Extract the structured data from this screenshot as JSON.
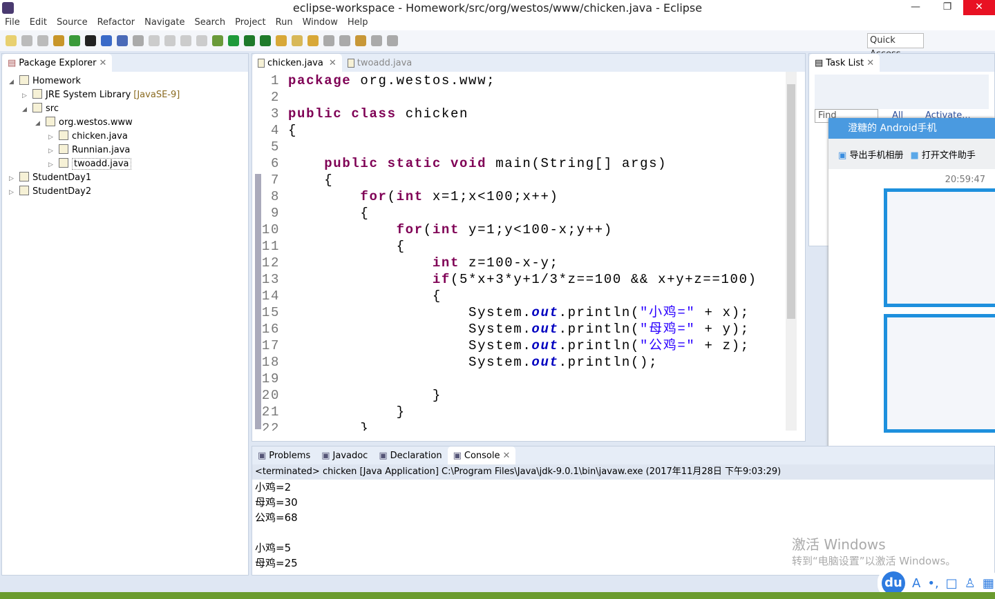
{
  "window": {
    "title": "eclipse-workspace - Homework/src/org/westos/www/chicken.java - Eclipse",
    "minimize": "—",
    "restore": "❐",
    "close": "✕"
  },
  "menu": [
    "File",
    "Edit",
    "Source",
    "Refactor",
    "Navigate",
    "Search",
    "Project",
    "Run",
    "Window",
    "Help"
  ],
  "quick_access": "Quick Access",
  "package_explorer": {
    "title": "Package Explorer",
    "tree": [
      {
        "label": "Homework",
        "depth": 0,
        "open": true
      },
      {
        "label": "JRE System Library",
        "extra": "[JavaSE-9]",
        "depth": 1,
        "open": false
      },
      {
        "label": "src",
        "depth": 1,
        "open": true
      },
      {
        "label": "org.westos.www",
        "depth": 2,
        "open": true
      },
      {
        "label": "chicken.java",
        "depth": 3,
        "open": false
      },
      {
        "label": "Runnian.java",
        "depth": 3,
        "open": false
      },
      {
        "label": "twoadd.java",
        "depth": 3,
        "open": false,
        "selected": true
      },
      {
        "label": "StudentDay1",
        "depth": 0,
        "open": false
      },
      {
        "label": "StudentDay2",
        "depth": 0,
        "open": false
      }
    ]
  },
  "editor": {
    "tabs": [
      {
        "label": "chicken.java",
        "active": true
      },
      {
        "label": "twoadd.java",
        "active": false
      }
    ],
    "lines": [
      [
        [
          "kw",
          "package"
        ],
        [
          "t",
          " org.westos.www;"
        ]
      ],
      [],
      [
        [
          "kw",
          "public"
        ],
        [
          "t",
          " "
        ],
        [
          "kw",
          "class"
        ],
        [
          "t",
          " chicken"
        ]
      ],
      [
        [
          "t",
          "{"
        ]
      ],
      [],
      [
        [
          "t",
          "    "
        ],
        [
          "kw",
          "public"
        ],
        [
          "t",
          " "
        ],
        [
          "kw",
          "static"
        ],
        [
          "t",
          " "
        ],
        [
          "kw",
          "void"
        ],
        [
          "t",
          " main(String[] args)"
        ]
      ],
      [
        [
          "t",
          "    {"
        ]
      ],
      [
        [
          "t",
          "        "
        ],
        [
          "kw",
          "for"
        ],
        [
          "t",
          "("
        ],
        [
          "kw",
          "int"
        ],
        [
          "t",
          " x=1;x<100;x++)"
        ]
      ],
      [
        [
          "t",
          "        {"
        ]
      ],
      [
        [
          "t",
          "            "
        ],
        [
          "kw",
          "for"
        ],
        [
          "t",
          "("
        ],
        [
          "kw",
          "int"
        ],
        [
          "t",
          " y=1;y<100-x;y++)"
        ]
      ],
      [
        [
          "t",
          "            {"
        ]
      ],
      [
        [
          "t",
          "                "
        ],
        [
          "kw",
          "int"
        ],
        [
          "t",
          " z=100-x-y;"
        ]
      ],
      [
        [
          "t",
          "                "
        ],
        [
          "kw",
          "if"
        ],
        [
          "t",
          "(5*x+3*y+1/3*z==100 && x+y+z==100)"
        ]
      ],
      [
        [
          "t",
          "                {"
        ]
      ],
      [
        [
          "t",
          "                    System."
        ],
        [
          "fld",
          "out"
        ],
        [
          "t",
          ".println("
        ],
        [
          "str",
          "\"小鸡=\""
        ],
        [
          "t",
          " + x);"
        ]
      ],
      [
        [
          "t",
          "                    System."
        ],
        [
          "fld",
          "out"
        ],
        [
          "t",
          ".println("
        ],
        [
          "str",
          "\"母鸡=\""
        ],
        [
          "t",
          " + y);"
        ]
      ],
      [
        [
          "t",
          "                    System."
        ],
        [
          "fld",
          "out"
        ],
        [
          "t",
          ".println("
        ],
        [
          "str",
          "\"公鸡=\""
        ],
        [
          "t",
          " + z);"
        ]
      ],
      [
        [
          "t",
          "                    System."
        ],
        [
          "fld",
          "out"
        ],
        [
          "t",
          ".println();"
        ]
      ],
      [],
      [
        [
          "t",
          "                }"
        ]
      ],
      [
        [
          "t",
          "            }"
        ]
      ],
      [
        [
          "t",
          "        }"
        ]
      ]
    ]
  },
  "task_list": {
    "title": "Task List",
    "find_placeholder": "Find",
    "all": "All",
    "activate": "Activate..."
  },
  "qq": {
    "title": "澄糖的 Android手机",
    "export": "导出手机相册",
    "open_helper": "打开文件助手",
    "time": "20:59:47"
  },
  "console": {
    "tabs": [
      "Problems",
      "Javadoc",
      "Declaration",
      "Console"
    ],
    "status": "<terminated> chicken [Java Application] C:\\Program Files\\Java\\jdk-9.0.1\\bin\\javaw.exe (2017年11月28日 下午9:03:29)",
    "output": [
      "小鸡=2",
      "母鸡=30",
      "公鸡=68",
      "",
      "小鸡=5",
      "母鸡=25"
    ]
  },
  "watermark": {
    "line1": "激活 Windows",
    "line2": "转到“电脑设置”以激活 Windows。"
  },
  "ime": {
    "logo": "du",
    "items": [
      "A",
      "•,",
      "□",
      "♙",
      "▦"
    ]
  },
  "colors": {
    "keyword": "#7f0055",
    "string": "#2a00ff",
    "field": "#0000c0",
    "qq_header": "#4a9ae0"
  }
}
